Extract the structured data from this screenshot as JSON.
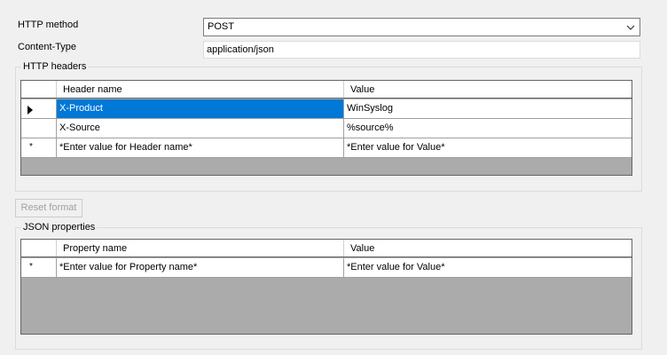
{
  "form": {
    "http_method_label": "HTTP method",
    "http_method_value": "POST",
    "content_type_label": "Content-Type",
    "content_type_value": "application/json"
  },
  "headers_group": {
    "title": "HTTP headers",
    "columns": [
      "Header name",
      "Value"
    ],
    "rows": [
      {
        "name": "X-Product",
        "value": "WinSyslog",
        "selected": true
      },
      {
        "name": "X-Source",
        "value": "%source%",
        "selected": false
      }
    ],
    "new_row": {
      "marker": "*",
      "name": "*Enter value for Header name*",
      "value": "*Enter value for Value*"
    }
  },
  "reset_button_label": "Reset format",
  "json_group": {
    "title": "JSON properties",
    "columns": [
      "Property name",
      "Value"
    ],
    "new_row": {
      "marker": "*",
      "name": "*Enter value for Property name*",
      "value": "*Enter value for Value*"
    }
  },
  "colors": {
    "selection": "#0078d7",
    "grid_background": "#ababab",
    "window_background": "#f0f0f0"
  }
}
